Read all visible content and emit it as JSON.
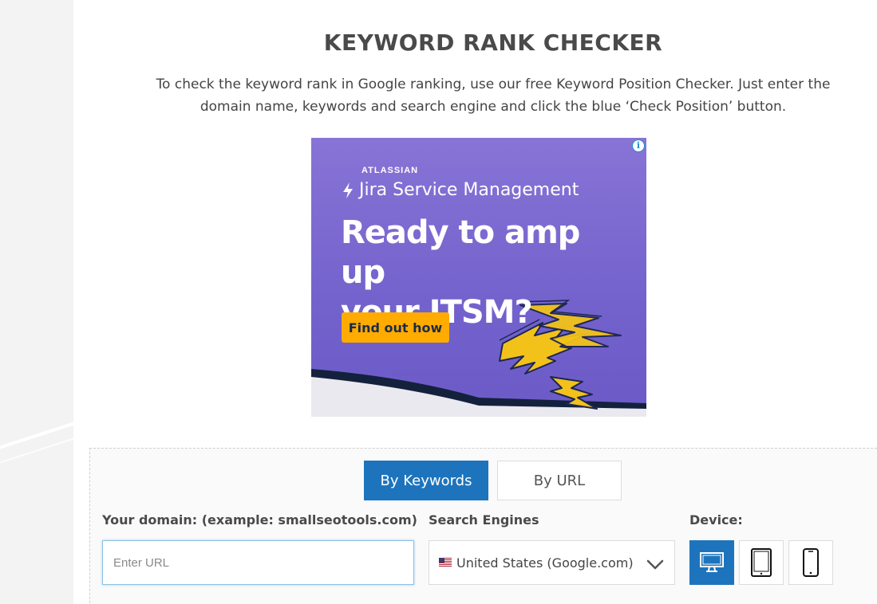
{
  "header": {
    "title": "KEYWORD RANK CHECKER",
    "intro_line1": "To check the keyword rank in Google ranking, use our free Keyword Position Checker. Just enter the",
    "intro_line2": "domain name, keywords and search engine and click the blue ‘Check Position’ button."
  },
  "ad": {
    "brand": "ATLASSIAN",
    "product": "Jira Service Management",
    "headline_line1": "Ready to amp up",
    "headline_line2": "your ITSM?",
    "cta": "Find out how",
    "info_icon": "i",
    "colors": {
      "background": "#7767cf",
      "cta": "#ffab00"
    }
  },
  "tool": {
    "tabs": [
      {
        "label": "By Keywords",
        "active": true
      },
      {
        "label": "By URL",
        "active": false
      }
    ],
    "domain_label": "Your domain: (example: smallseotools.com)",
    "domain_placeholder": "Enter URL",
    "engine_label": "Search Engines",
    "engine_selected": "United States (Google.com)",
    "device_label": "Device:",
    "devices": [
      {
        "icon": "desktop-icon",
        "active": true
      },
      {
        "icon": "tablet-icon",
        "active": false
      },
      {
        "icon": "mobile-icon",
        "active": false
      }
    ],
    "accent_color": "#1d74bd"
  }
}
